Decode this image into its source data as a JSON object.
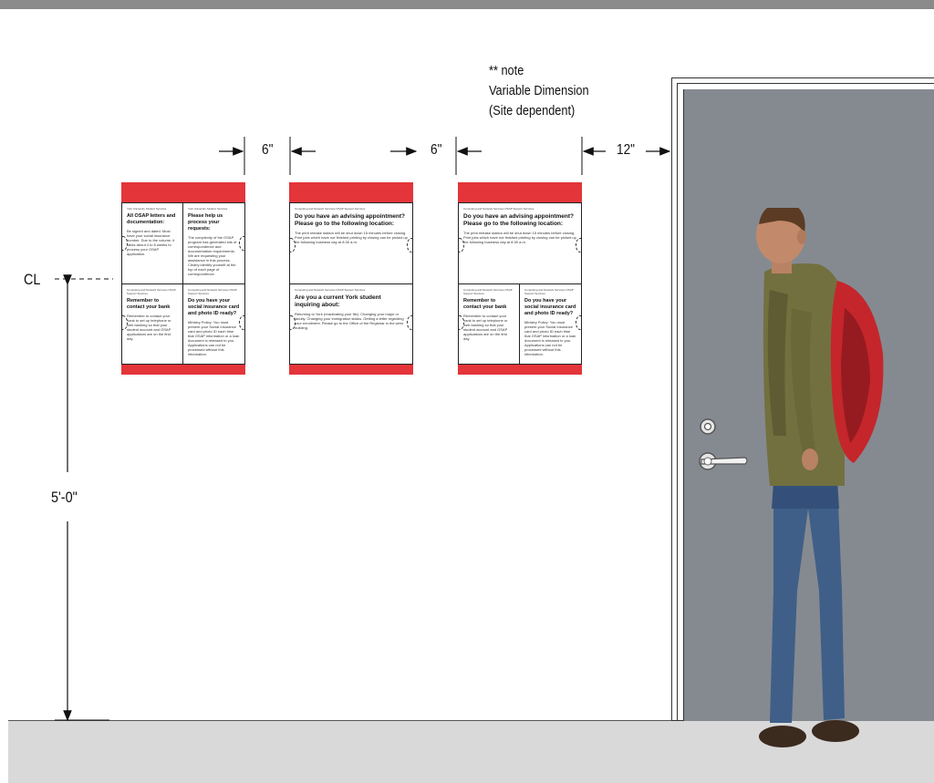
{
  "note": {
    "line1": "** note",
    "line2": "Variable Dimension",
    "line3": "(Site dependent)"
  },
  "dimensions": {
    "gap_a": "6\"",
    "gap_b": "6\"",
    "gap_c": "12\"",
    "centerline": "CL",
    "height": "5'-0\""
  },
  "posters": [
    {
      "panels": [
        {
          "small": "York University Student Services",
          "head": "All OSAP letters and documentation:",
          "body": "Be signed and dated. Must have your social insurance number. Due to the volume, it takes about 4 to 6 weeks to process your OSAP application."
        },
        {
          "small": "York University Student Services",
          "head": "Please help us process your requests:",
          "body": "The complexity of the OSAP program has generated lots of correspondence and documentation requirements. We are requesting your assistance in this process. Clearly identify yourself at the top of each page of correspondence."
        },
        {
          "small": "Computing and Network Services OSAP Support Services",
          "head": "Remember to contact your bank",
          "body": "Remember to contact your bank to set up telephone or web banking so that your student account and OSAP applications are on the first day."
        },
        {
          "small": "Computing and Network Services OSAP Support Services",
          "head": "Do you have your social insurance card and photo ID ready?",
          "body": "Ministry Policy: You must present your Social Insurance card and photo ID each time that OSAP information or a loan document is released to you. Applications can not be processed without this information."
        }
      ]
    },
    {
      "panels": [
        {
          "small": "Computing and Network Services OSAP Support Services",
          "head": "Do you have an advising appointment? Please go to the following location:",
          "body": "The print release station will be shut down 15 minutes before closing. Print jobs which have not finished printing by closing can be picked up the following business day at 8:30 a.m."
        },
        {
          "small": "Computing and Network Services OSAP Support Services",
          "head": "Are you a current York student inquiring about:",
          "body": "Returning to York (reactivating your file). Changing your major or faculty. Changing your immigration status. Getting a letter regarding your enrollment. Please go to the Office of the Registrar in the west building."
        }
      ]
    },
    {
      "panels": [
        {
          "small": "Computing and Network Services OSAP Support Services",
          "head": "Do you have an advising appointment? Please go to the following location:",
          "body": "The print release station will be shut down 15 minutes before closing. Print jobs which have not finished printing by closing can be picked up the following business day at 8:30 a.m."
        },
        {
          "small": "Computing and Network Services OSAP Support Services",
          "head": "Remember to contact your bank",
          "body": "Remember to contact your bank to set up telephone or web banking so that your student account and OSAP applications are on the first day."
        },
        {
          "small": "Computing and Network Services OSAP Support Services",
          "head": "Do you have your social insurance card and photo ID ready?",
          "body": "Ministry Policy: You must present your Social Insurance card and photo ID each time that OSAP information or a loan document is released to you. Applications can not be processed without this information."
        }
      ]
    }
  ],
  "colors": {
    "poster_band": "#e3353a",
    "door": "#858a91",
    "floor": "#d9d9da"
  }
}
